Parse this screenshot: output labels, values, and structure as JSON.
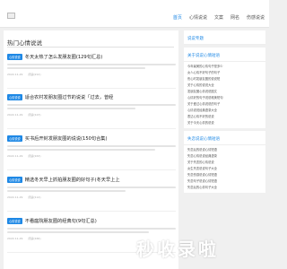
{
  "header": {
    "nav": [
      "首页",
      "心情说说",
      "文案",
      "网名",
      "伤感说说"
    ]
  },
  "main": {
    "section_title": "热门心情说说",
    "articles": [
      {
        "tag": "心情说说",
        "title": "冬天太热了怎么发朋友圈(129句汇总)",
        "date": "2022-11-29",
        "views": "阅读(212)"
      },
      {
        "tag": "心情说说",
        "title": "适合农村发朋友圈过节的说说「过去，曾经",
        "date": "2022-11-29",
        "views": "阅读(123)"
      },
      {
        "tag": "心情说说",
        "title": "买书后开封发朋友圈的说说(150句合集)",
        "date": "2022-11-29",
        "views": "阅读(163)"
      },
      {
        "tag": "心情说说",
        "title": "精选冬天早上抓拍朋友圈的好句子(冬天早上上",
        "date": "2022-11-29",
        "views": "阅读(114)"
      },
      {
        "tag": "心情说说",
        "title": "不看庭院朋友圈的经典句(9句汇总)",
        "date": "2022-11-29",
        "views": "阅读(166)"
      }
    ]
  },
  "sidebar": {
    "box1": {
      "title": "说说专题"
    },
    "box2": {
      "title": "关于说说心情短语",
      "items": [
        "今年最美的心情句子是多少",
        "女人心情不好句子的句子",
        "伤心时发朋友圈的说说短",
        "关于心情的说说大全",
        "发朋友圈心情说说图文",
        "心情好的句子说说唯美短句",
        "关于爱过心情说说的句子",
        "心情说说经典语录大全",
        "表达心情不好的说说",
        "关于今天心情的说说"
      ]
    },
    "box3": {
      "title": "失恋说说心情短语",
      "items": [
        "失恋后的说说心情短语",
        "失恋心情说说经典语录",
        "关于失恋的心情说说",
        "女生失恋说说句子大全",
        "失恋伤感说说心情短语",
        "失恋句子说说心情短语",
        "失恋后的心情句子大全"
      ]
    }
  },
  "watermark": "秒收录啦"
}
